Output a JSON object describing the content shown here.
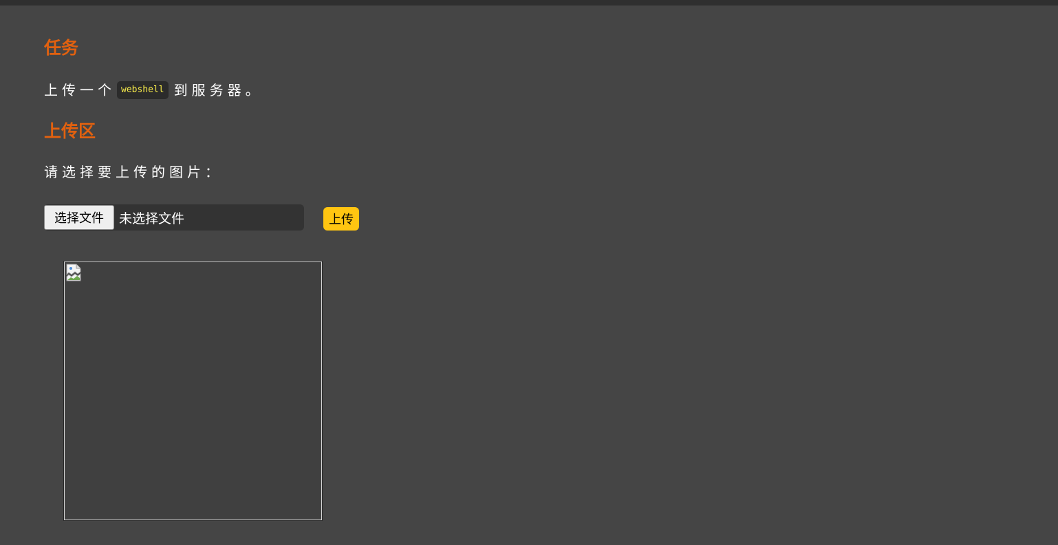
{
  "task": {
    "heading": "任务",
    "text_before": "上传一个",
    "code": "webshell",
    "text_after": "到服务器。"
  },
  "upload": {
    "heading": "上传区",
    "prompt": "请选择要上传的图片：",
    "choose_file_label": "选择文件",
    "file_status": "未选择文件",
    "submit_label": "上传"
  },
  "preview": {
    "icon": "broken-image-icon"
  },
  "colors": {
    "background": "#454545",
    "heading": "#e2610f",
    "code_text": "#f5e94a",
    "upload_button": "#ffc511"
  }
}
